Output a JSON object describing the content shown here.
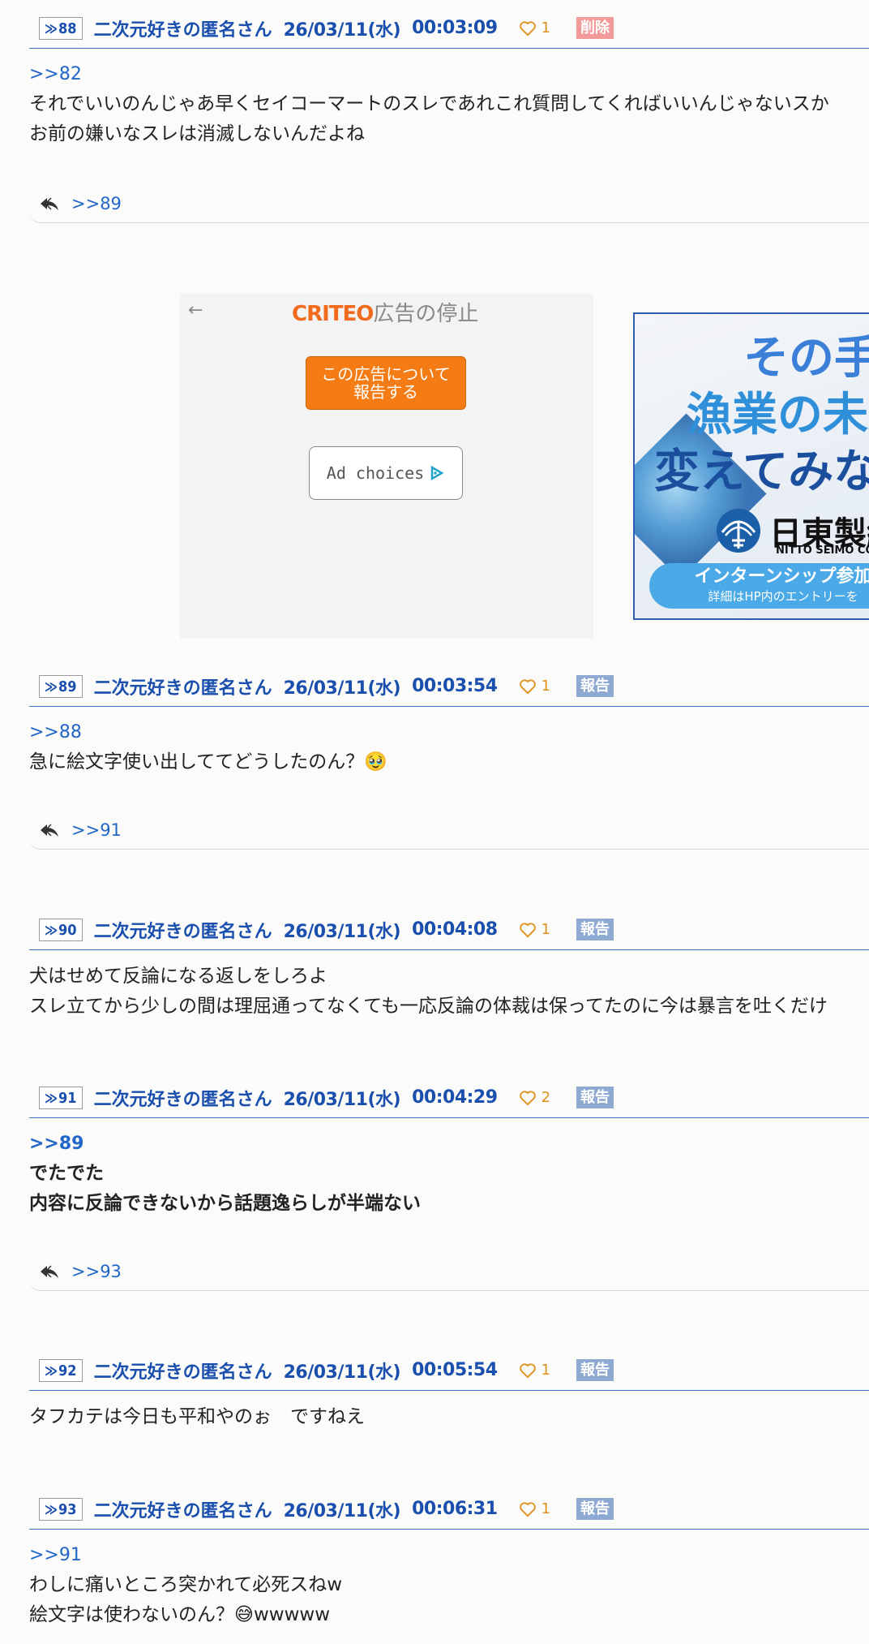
{
  "posts": [
    {
      "num": "88",
      "name": "二次元好きの匿名さん",
      "date": "26/03/11(水)",
      "time": "00:03:09",
      "likes": "1",
      "badge": "削除",
      "badge_type": "delete",
      "anchor": ">>82",
      "lines": [
        "それでいいのんじゃあ早くセイコーマートのスレであれこれ質問してくればいいんじゃないスか",
        "お前の嫌いなスレは消滅しないんだよね"
      ],
      "reply": ">>89"
    },
    {
      "num": "89",
      "name": "二次元好きの匿名さん",
      "date": "26/03/11(水)",
      "time": "00:03:54",
      "likes": "1",
      "badge": "報告",
      "badge_type": "report",
      "anchor": ">>88",
      "lines": [
        "急に絵文字使い出しててどうしたのん？🥹"
      ],
      "reply": ">>91"
    },
    {
      "num": "90",
      "name": "二次元好きの匿名さん",
      "date": "26/03/11(水)",
      "time": "00:04:08",
      "likes": "1",
      "badge": "報告",
      "badge_type": "report",
      "lines": [
        "犬はせめて反論になる返しをしろよ",
        "スレ立てから少しの間は理屈通ってなくても一応反論の体裁は保ってたのに今は暴言を吐くだけ"
      ]
    },
    {
      "num": "91",
      "name": "二次元好きの匿名さん",
      "date": "26/03/11(水)",
      "time": "00:04:29",
      "likes": "2",
      "badge": "報告",
      "badge_type": "report",
      "anchor": ">>89",
      "lines": [
        "でたでた",
        "内容に反論できないから話題逸らしが半端ない"
      ],
      "reply": ">>93"
    },
    {
      "num": "92",
      "name": "二次元好きの匿名さん",
      "date": "26/03/11(水)",
      "time": "00:05:54",
      "likes": "1",
      "badge": "報告",
      "badge_type": "report",
      "lines": [
        "タフカテは今日も平和やのぉ　ですねえ"
      ]
    },
    {
      "num": "93",
      "name": "二次元好きの匿名さん",
      "date": "26/03/11(水)",
      "time": "00:06:31",
      "likes": "1",
      "badge": "報告",
      "badge_type": "report",
      "anchor": ">>91",
      "lines": [
        "わしに痛いところ突かれて必死スねw",
        "絵文字は使わないのん？😅wwwww"
      ]
    }
  ],
  "ads": {
    "criteo": {
      "back_arrow": "←",
      "logo": "CRITEO",
      "stop_label": "広告の停止",
      "report_line1": "この広告について",
      "report_line2": "報告する",
      "choices_label": "Ad choices"
    },
    "nitto": {
      "tag1": "その手で",
      "tag2": "漁業の未来",
      "tag3": "変えてみない",
      "company": "日東製網",
      "company_en": "NITTO SEIMO CO.,LTD.",
      "cta1": "インターンシップ参加",
      "cta2": "詳細はHP内のエントリーを"
    }
  }
}
